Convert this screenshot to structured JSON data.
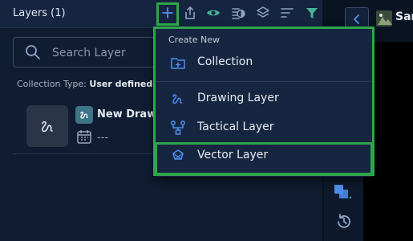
{
  "panel": {
    "title": "Layers (1)",
    "search_placeholder": "Search Layer",
    "collection_type_label": "Collection Type:",
    "collection_type_value": "User defined",
    "layers": [
      {
        "name": "New Drawin",
        "date": "---"
      }
    ]
  },
  "toolbar_icons": [
    "add-icon",
    "share-icon",
    "eye-icon",
    "contrast-icon",
    "layers-icon",
    "sort-icon",
    "filter-icon"
  ],
  "dropdown": {
    "header": "Create New",
    "items": [
      {
        "label": "Collection",
        "icon": "folder-add-icon"
      },
      {
        "label": "Drawing Layer",
        "icon": "drawing-icon"
      },
      {
        "label": "Tactical Layer",
        "icon": "tactical-icon"
      },
      {
        "label": "Vector Layer",
        "icon": "vector-icon"
      }
    ]
  },
  "document": {
    "title": "Sam"
  },
  "colors": {
    "highlight": "#2ea64b",
    "accent": "#4d8ef0",
    "panel_bg": "#122038",
    "menu_bg": "#172640"
  }
}
